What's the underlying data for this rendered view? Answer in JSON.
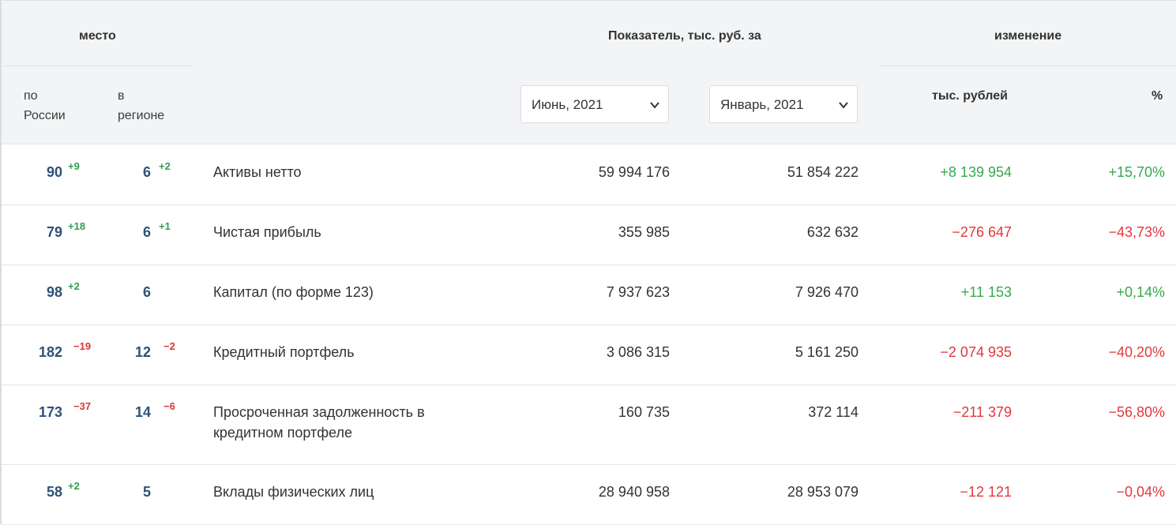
{
  "header": {
    "place_label": "место",
    "indicator_label": "Показатель, тыс. руб. за",
    "change_label": "изменение",
    "russia_label_1": "по",
    "russia_label_2": "России",
    "region_label_1": "в",
    "region_label_2": "регионе",
    "abs_label": "тыс. рублей",
    "pct_label": "%",
    "period1": "Июнь, 2021",
    "period2": "Январь, 2021"
  },
  "colors": {
    "rank": "#2f5277",
    "positive": "#37a84e",
    "negative": "#e0383c",
    "header_bg": "#f2f4f6"
  },
  "rows": [
    {
      "rank_ru": "90",
      "rank_ru_delta": "+9",
      "rank_reg": "6",
      "rank_reg_delta": "+2",
      "name": "Активы нетто",
      "name2": "",
      "v1": "59 994 176",
      "v2": "51 854 222",
      "chg": "+8 139 954",
      "pct": "+15,70%"
    },
    {
      "rank_ru": "79",
      "rank_ru_delta": "+18",
      "rank_reg": "6",
      "rank_reg_delta": "+1",
      "name": "Чистая прибыль",
      "name2": "",
      "v1": "355 985",
      "v2": "632 632",
      "chg": "−276 647",
      "pct": "−43,73%"
    },
    {
      "rank_ru": "98",
      "rank_ru_delta": "+2",
      "rank_reg": "6",
      "rank_reg_delta": "",
      "name": "Капитал (по форме 123)",
      "name2": "",
      "v1": "7 937 623",
      "v2": "7 926 470",
      "chg": "+11 153",
      "pct": "+0,14%"
    },
    {
      "rank_ru": "182",
      "rank_ru_delta": "−19",
      "rank_reg": "12",
      "rank_reg_delta": "−2",
      "name": "Кредитный портфель",
      "name2": "",
      "v1": "3 086 315",
      "v2": "5 161 250",
      "chg": "−2 074 935",
      "pct": "−40,20%"
    },
    {
      "rank_ru": "173",
      "rank_ru_delta": "−37",
      "rank_reg": "14",
      "rank_reg_delta": "−6",
      "name": "Просроченная задолженность в",
      "name2": "кредитном портфеле",
      "v1": "160 735",
      "v2": "372 114",
      "chg": "−211 379",
      "pct": "−56,80%"
    },
    {
      "rank_ru": "58",
      "rank_ru_delta": "+2",
      "rank_reg": "5",
      "rank_reg_delta": "",
      "name": "Вклады физических лиц",
      "name2": "",
      "v1": "28 940 958",
      "v2": "28 953 079",
      "chg": "−12 121",
      "pct": "−0,04%"
    }
  ]
}
